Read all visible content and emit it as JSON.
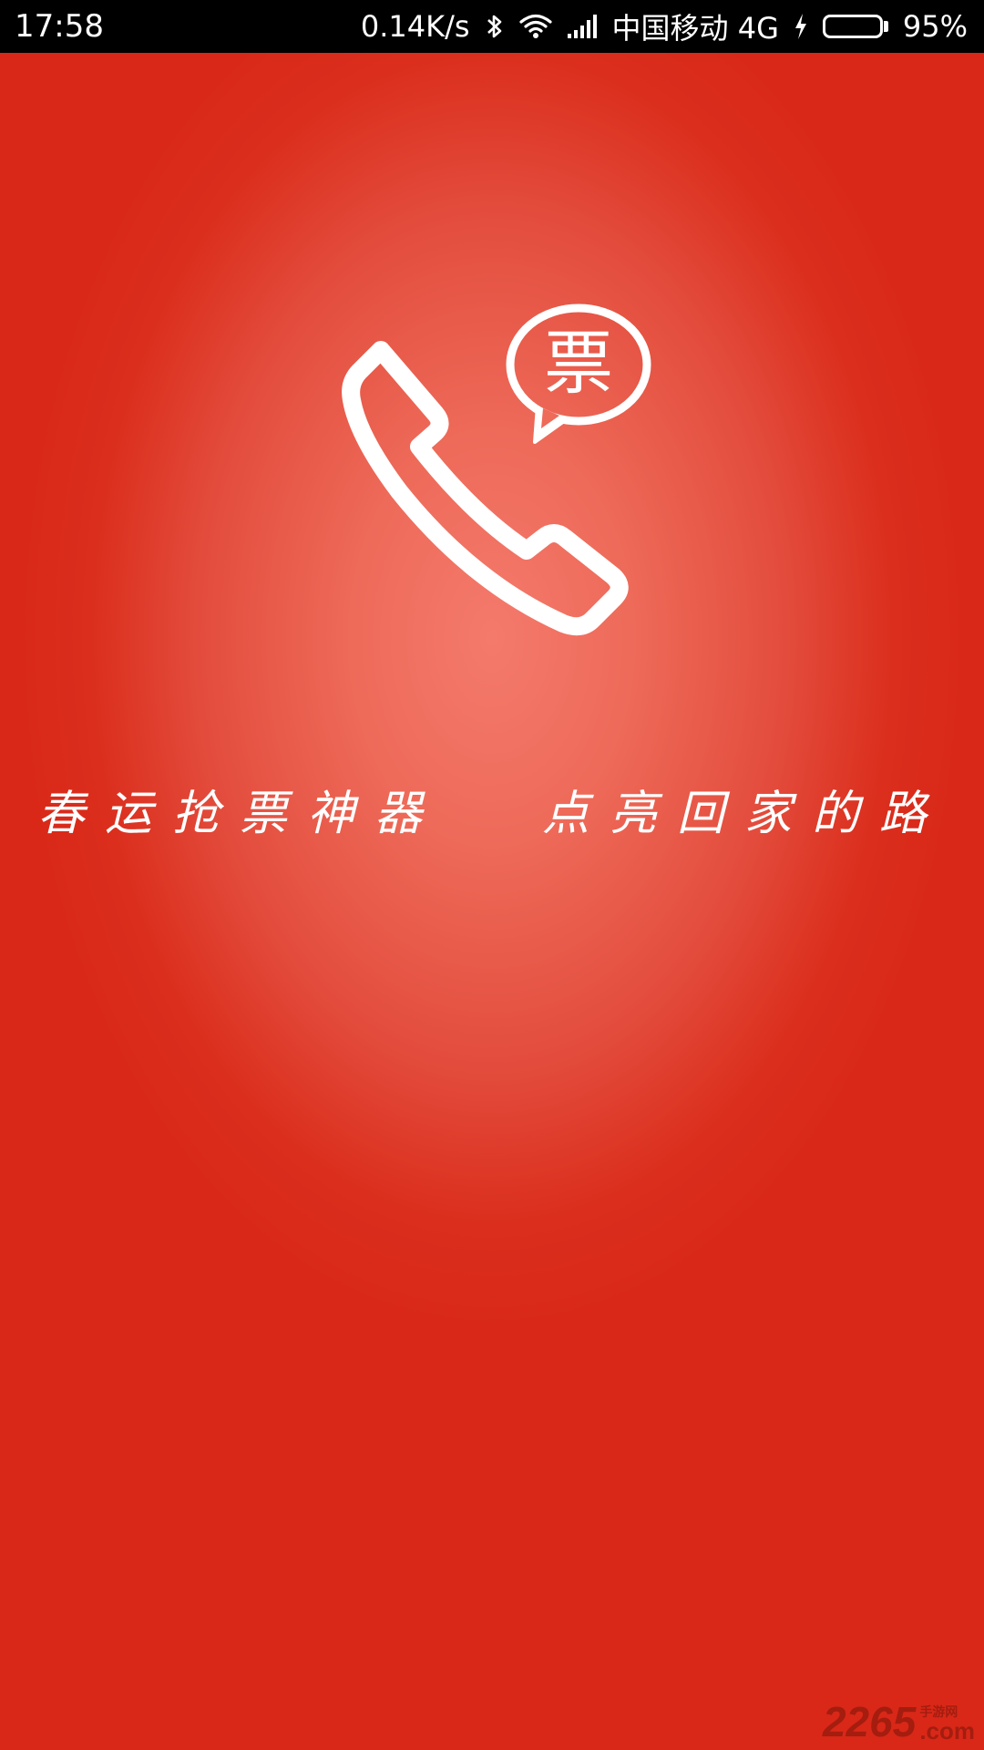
{
  "status_bar": {
    "time": "17:58",
    "net_speed": "0.14K/s",
    "carrier": "中国移动 4G",
    "battery": "95%",
    "battery_level": 0.95,
    "icons": [
      "bluetooth-icon",
      "wifi-icon",
      "signal-icon",
      "charging-icon",
      "battery-icon"
    ]
  },
  "logo": {
    "bubble_text": "票",
    "icon": "phone-handset-icon"
  },
  "slogan": {
    "left": "春运抢票神器",
    "right": "点亮回家的路"
  },
  "watermark": {
    "number": "2265",
    "site": "手游网",
    "domain": ".com"
  },
  "colors": {
    "background_center": "#f47a6c",
    "background_edge": "#d92818",
    "status_bar": "#000000",
    "battery_fill": "#6ee02a"
  }
}
